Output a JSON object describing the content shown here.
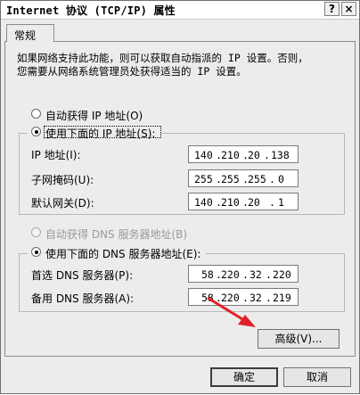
{
  "window": {
    "title": "Internet 协议 (TCP/IP) 属性",
    "help_btn": "?",
    "close_btn": "×"
  },
  "tab": {
    "label": "常规"
  },
  "description": {
    "line1": "如果网络支持此功能，则可以获取自动指派的 IP 设置。否则，",
    "line2": "您需要从网络系统管理员处获得适当的 IP 设置。"
  },
  "ip": {
    "auto_label": "自动获得 IP 地址(O)",
    "manual_label": "使用下面的 IP 地址(S):",
    "selected": "manual",
    "address_label": "IP 地址(I):",
    "address": [
      "140",
      "210",
      "20",
      "138"
    ],
    "mask_label": "子网掩码(U):",
    "mask": [
      "255",
      "255",
      "255",
      "0"
    ],
    "gateway_label": "默认网关(D):",
    "gateway": [
      "140",
      "210",
      "20",
      "1"
    ]
  },
  "dns": {
    "auto_label": "自动获得 DNS 服务器地址(B)",
    "manual_label": "使用下面的 DNS 服务器地址(E):",
    "selected": "manual",
    "preferred_label": "首选 DNS 服务器(P):",
    "preferred": [
      "58",
      "220",
      "32",
      "220"
    ],
    "alternate_label": "备用 DNS 服务器(A):",
    "alternate": [
      "58",
      "220",
      "32",
      "219"
    ]
  },
  "buttons": {
    "advanced": "高级(V)...",
    "ok": "确定",
    "cancel": "取消"
  },
  "colors": {
    "annotation_arrow": "#e0202a"
  }
}
